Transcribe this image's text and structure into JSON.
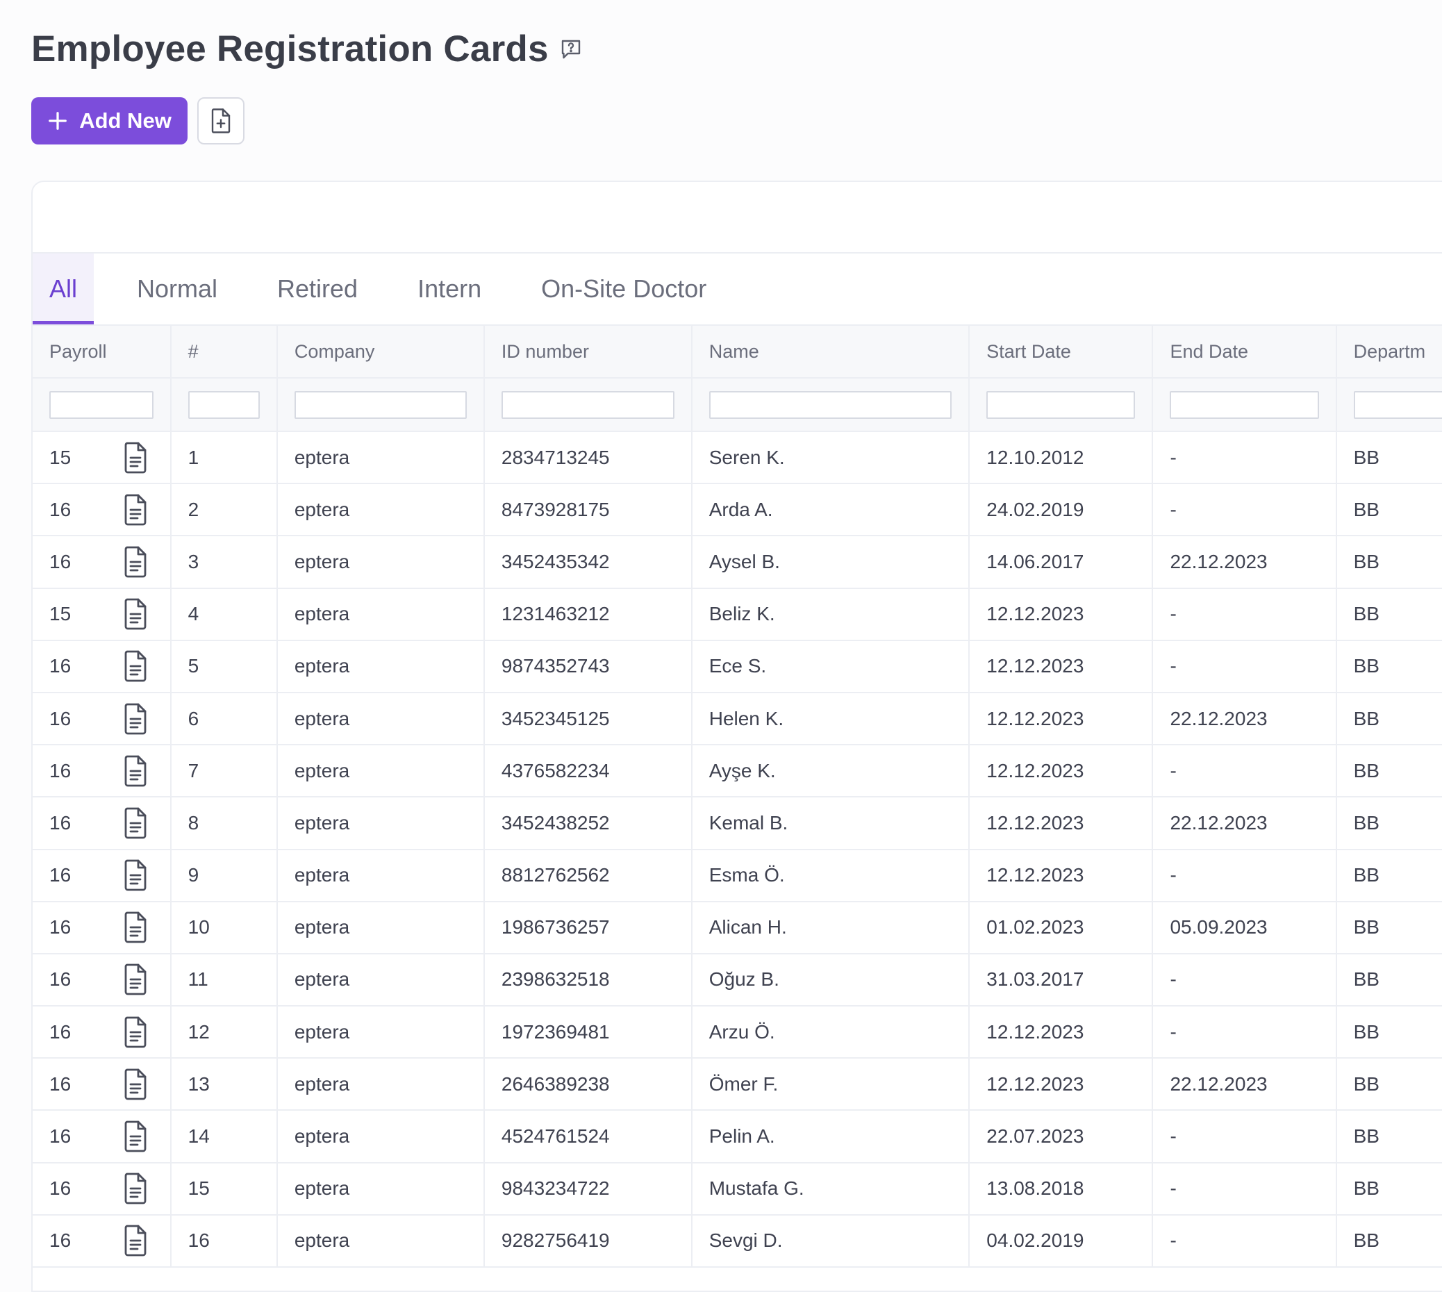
{
  "page": {
    "title": "Employee Registration Cards",
    "help_icon": "help-chat-icon"
  },
  "toolbar": {
    "add_new_label": "Add New",
    "add_icon": "plus-icon",
    "doc_icon": "file-add-icon"
  },
  "colors": {
    "accent": "#7c4ddb",
    "tab_active_bg": "#f3f1fb",
    "border": "#eceef3"
  },
  "tabs": [
    {
      "label": "All",
      "active": true
    },
    {
      "label": "Normal",
      "active": false
    },
    {
      "label": "Retired",
      "active": false
    },
    {
      "label": "Intern",
      "active": false
    },
    {
      "label": "On-Site Doctor",
      "active": false
    }
  ],
  "table": {
    "columns": [
      "Payroll",
      "#",
      "Company",
      "ID number",
      "Name",
      "Start Date",
      "End Date",
      "Departm"
    ],
    "row_icon": "document-icon",
    "rows": [
      {
        "payroll": "15",
        "num": "1",
        "company": "eptera",
        "id": "2834713245",
        "name": "Seren K.",
        "start": "12.10.2012",
        "end": "-",
        "dept": "BB"
      },
      {
        "payroll": "16",
        "num": "2",
        "company": "eptera",
        "id": "8473928175",
        "name": "Arda A.",
        "start": "24.02.2019",
        "end": "-",
        "dept": "BB"
      },
      {
        "payroll": "16",
        "num": "3",
        "company": "eptera",
        "id": "3452435342",
        "name": "Aysel B.",
        "start": "14.06.2017",
        "end": "22.12.2023",
        "dept": "BB"
      },
      {
        "payroll": "15",
        "num": "4",
        "company": "eptera",
        "id": "1231463212",
        "name": "Beliz K.",
        "start": "12.12.2023",
        "end": "-",
        "dept": "BB"
      },
      {
        "payroll": "16",
        "num": "5",
        "company": "eptera",
        "id": "9874352743",
        "name": "Ece S.",
        "start": "12.12.2023",
        "end": "-",
        "dept": "BB"
      },
      {
        "payroll": "16",
        "num": "6",
        "company": "eptera",
        "id": "3452345125",
        "name": "Helen K.",
        "start": "12.12.2023",
        "end": "22.12.2023",
        "dept": "BB"
      },
      {
        "payroll": "16",
        "num": "7",
        "company": "eptera",
        "id": "4376582234",
        "name": "Ayşe K.",
        "start": "12.12.2023",
        "end": "-",
        "dept": "BB"
      },
      {
        "payroll": "16",
        "num": "8",
        "company": "eptera",
        "id": "3452438252",
        "name": "Kemal B.",
        "start": "12.12.2023",
        "end": "22.12.2023",
        "dept": "BB"
      },
      {
        "payroll": "16",
        "num": "9",
        "company": "eptera",
        "id": "8812762562",
        "name": "Esma Ö.",
        "start": "12.12.2023",
        "end": "-",
        "dept": "BB"
      },
      {
        "payroll": "16",
        "num": "10",
        "company": "eptera",
        "id": "1986736257",
        "name": "Alican H.",
        "start": "01.02.2023",
        "end": "05.09.2023",
        "dept": "BB"
      },
      {
        "payroll": "16",
        "num": "11",
        "company": "eptera",
        "id": "2398632518",
        "name": "Oğuz B.",
        "start": "31.03.2017",
        "end": "-",
        "dept": "BB"
      },
      {
        "payroll": "16",
        "num": "12",
        "company": "eptera",
        "id": "1972369481",
        "name": "Arzu Ö.",
        "start": "12.12.2023",
        "end": "-",
        "dept": "BB"
      },
      {
        "payroll": "16",
        "num": "13",
        "company": "eptera",
        "id": "2646389238",
        "name": "Ömer F.",
        "start": "12.12.2023",
        "end": "22.12.2023",
        "dept": "BB"
      },
      {
        "payroll": "16",
        "num": "14",
        "company": "eptera",
        "id": "4524761524",
        "name": "Pelin A.",
        "start": "22.07.2023",
        "end": "-",
        "dept": "BB"
      },
      {
        "payroll": "16",
        "num": "15",
        "company": "eptera",
        "id": "9843234722",
        "name": "Mustafa G.",
        "start": "13.08.2018",
        "end": "-",
        "dept": "BB"
      },
      {
        "payroll": "16",
        "num": "16",
        "company": "eptera",
        "id": "9282756419",
        "name": "Sevgi D.",
        "start": "04.02.2019",
        "end": "-",
        "dept": "BB"
      }
    ]
  }
}
